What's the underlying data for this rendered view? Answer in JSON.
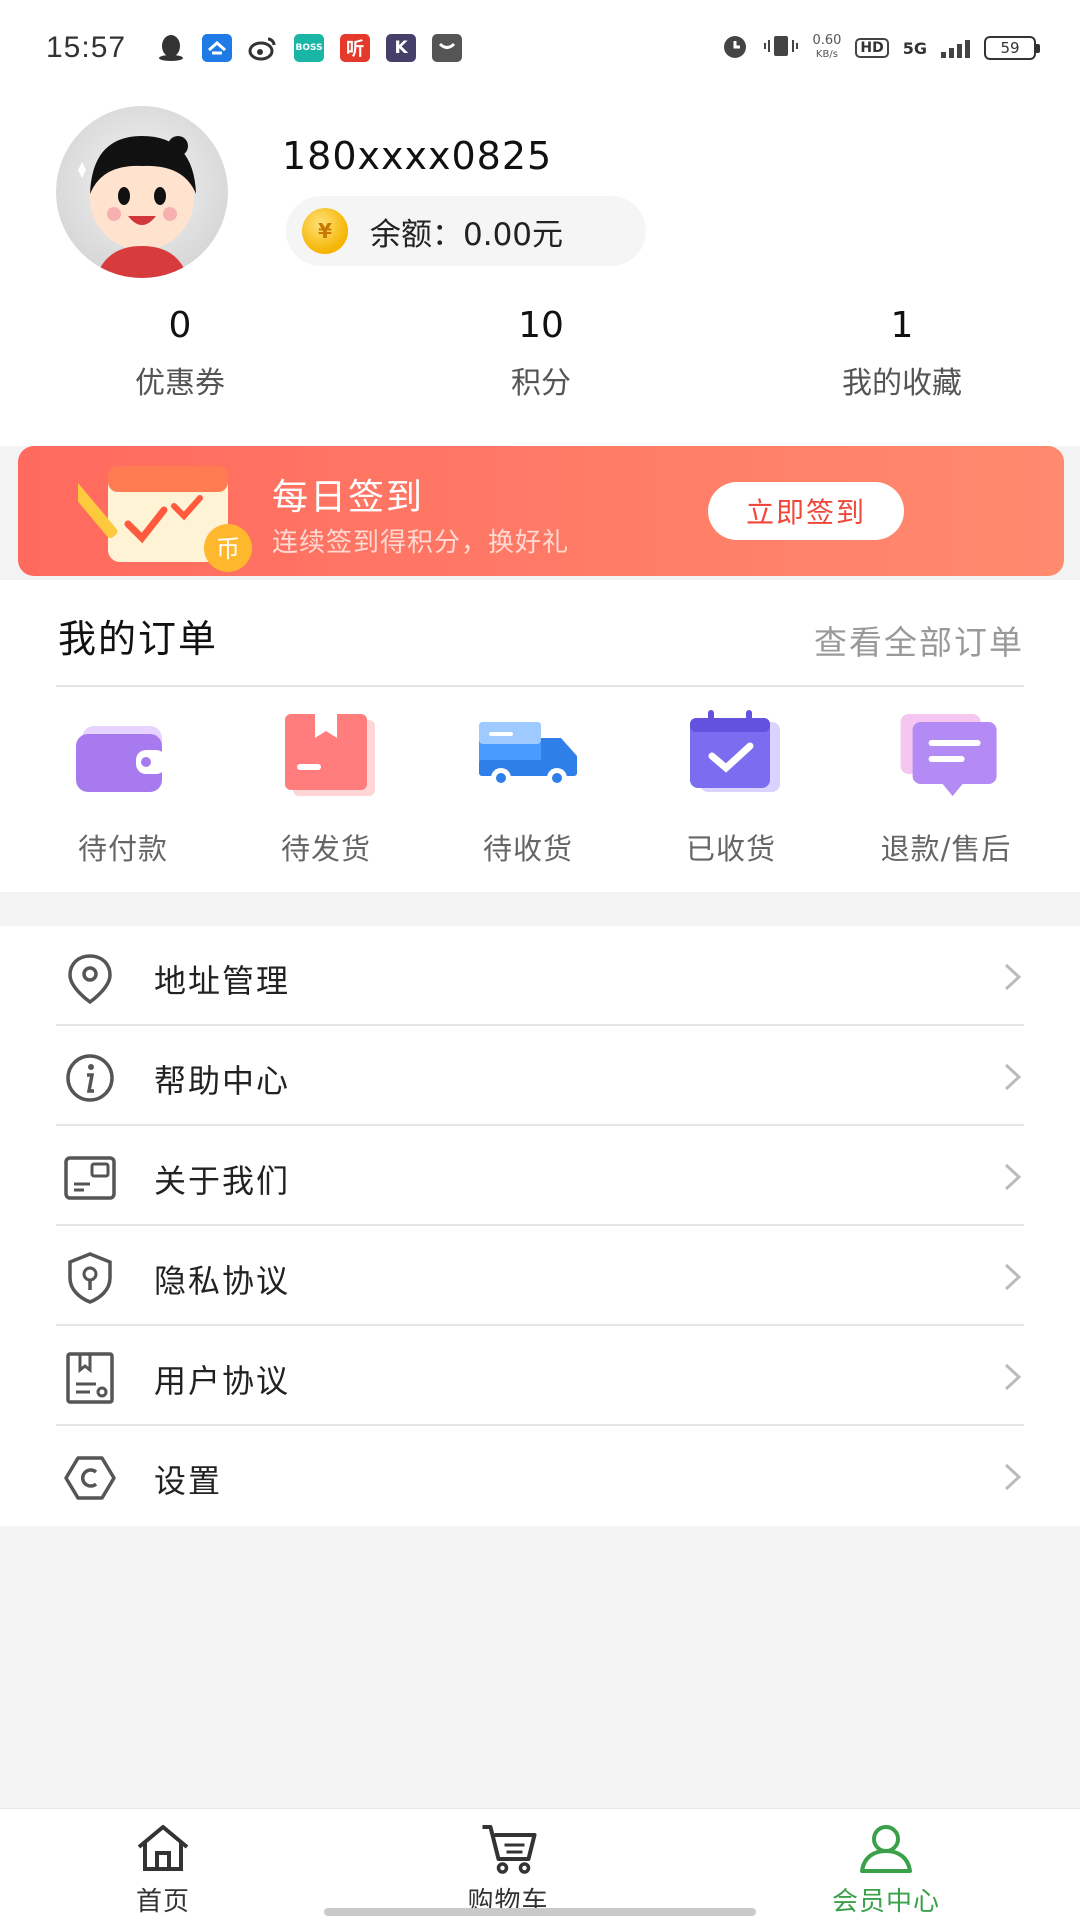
{
  "status_bar": {
    "time": "15:57",
    "app_icons": [
      {
        "name": "qq-icon",
        "color": "#333333",
        "text": ""
      },
      {
        "name": "browser-icon",
        "color": "#1e7be6",
        "text": ""
      },
      {
        "name": "weibo-icon",
        "color": "#333333",
        "text": ""
      },
      {
        "name": "boss-zhipin-icon",
        "color": "#19b6a6",
        "text": "BOSS"
      },
      {
        "name": "ting-icon",
        "color": "#e53a2b",
        "text": "听"
      },
      {
        "name": "k-app-icon",
        "color": "#45406a",
        "text": "K"
      },
      {
        "name": "message-app-icon",
        "color": "#555555",
        "text": ""
      }
    ],
    "net_speed_value": "0.60",
    "net_speed_unit": "KB/s",
    "hd_label": "HD",
    "network_label": "5G",
    "battery": "59"
  },
  "profile": {
    "phone": "180xxxx0825",
    "balance": "余额：0.00元",
    "coin_symbol": "¥"
  },
  "stats": [
    {
      "value": "0",
      "label": "优惠券"
    },
    {
      "value": "10",
      "label": "积分"
    },
    {
      "value": "1",
      "label": "我的收藏"
    }
  ],
  "signin": {
    "title": "每日签到",
    "subtitle": "连续签到得积分，换好礼",
    "button": "立即签到",
    "coin_text": "币"
  },
  "orders": {
    "title": "我的订单",
    "view_all": "查看全部订单",
    "items": [
      {
        "label": "待付款",
        "icon": "wallet-icon"
      },
      {
        "label": "待发货",
        "icon": "package-icon"
      },
      {
        "label": "待收货",
        "icon": "truck-icon"
      },
      {
        "label": "已收货",
        "icon": "calendar-check-icon"
      },
      {
        "label": "退款/售后",
        "icon": "refund-message-icon"
      }
    ]
  },
  "menu": [
    {
      "label": "地址管理",
      "icon": "location-pin-icon"
    },
    {
      "label": "帮助中心",
      "icon": "info-icon"
    },
    {
      "label": "关于我们",
      "icon": "id-card-icon"
    },
    {
      "label": "隐私协议",
      "icon": "privacy-shield-icon"
    },
    {
      "label": "用户协议",
      "icon": "agreement-doc-icon"
    },
    {
      "label": "设置",
      "icon": "settings-icon"
    }
  ],
  "bottom_nav": [
    {
      "label": "首页",
      "icon": "home-icon",
      "active": false
    },
    {
      "label": "购物车",
      "icon": "cart-icon",
      "active": false
    },
    {
      "label": "会员中心",
      "icon": "member-icon",
      "active": true
    }
  ],
  "colors": {
    "accent_green": "#3aa14a",
    "signin_gradient_start": "#ff6a5e",
    "signin_gradient_end": "#ff8a6e",
    "signin_button_text": "#f0473a"
  }
}
